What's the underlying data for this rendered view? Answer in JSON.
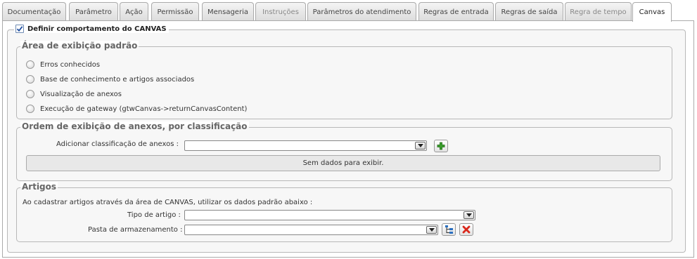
{
  "tabs": [
    {
      "label": "Documentação",
      "state": "normal"
    },
    {
      "label": "Parâmetro",
      "state": "normal"
    },
    {
      "label": "Ação",
      "state": "normal"
    },
    {
      "label": "Permissão",
      "state": "normal"
    },
    {
      "label": "Mensageria",
      "state": "normal"
    },
    {
      "label": "Instruções",
      "state": "disabled"
    },
    {
      "label": "Parâmetros do atendimento",
      "state": "normal"
    },
    {
      "label": "Regras de entrada",
      "state": "normal"
    },
    {
      "label": "Regras de saída",
      "state": "normal"
    },
    {
      "label": "Regra de tempo",
      "state": "disabled"
    },
    {
      "label": "Canvas",
      "state": "active"
    }
  ],
  "canvas": {
    "define_label": "Definir comportamento do CANVAS",
    "define_checked": true,
    "display_area": {
      "legend": "Área de exibição padrão",
      "options": [
        "Erros conhecidos",
        "Base de conhecimento e artigos associados",
        "Visualização de anexos",
        "Execução de gateway (gtwCanvas->returnCanvasContent)"
      ]
    },
    "attachments": {
      "legend": "Ordem de exibição de anexos, por classificação",
      "add_label": "Adicionar classificação de anexos :",
      "add_value": "",
      "empty_text": "Sem dados para exibir."
    },
    "articles": {
      "legend": "Artigos",
      "description": "Ao cadastrar artigos através da área de CANVAS, utilizar os dados padrão abaixo :",
      "type_label": "Tipo de artigo :",
      "type_value": "",
      "folder_label": "Pasta de armazenamento :",
      "folder_value": ""
    }
  },
  "colors": {
    "add_icon": "#3aa02c",
    "remove_icon": "#d9281c",
    "tree_icon": "#2a6fc0",
    "check": "#1f4ea0"
  }
}
